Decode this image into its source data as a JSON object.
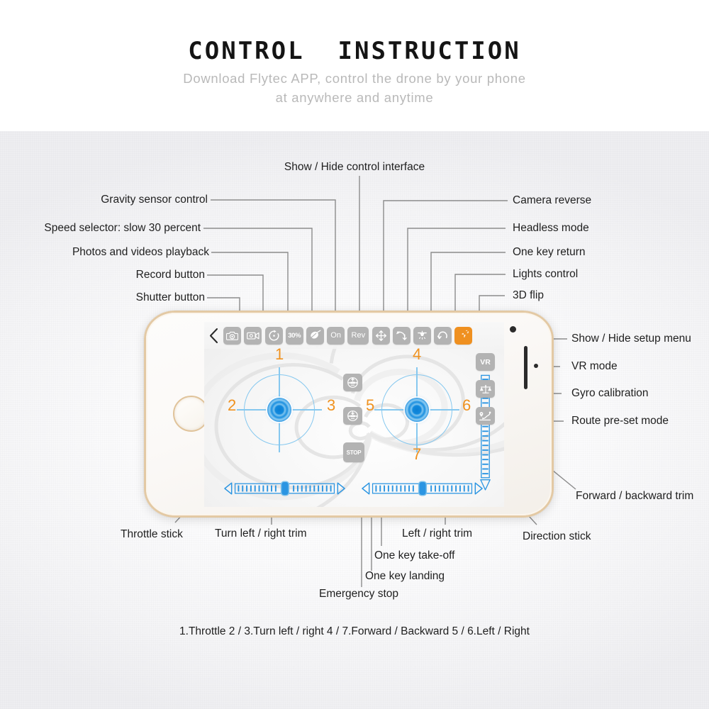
{
  "header": {
    "title": "CONTROL  INSTRUCTION",
    "subtitle_line1": "Download Flytec APP, control the drone by your phone",
    "subtitle_line2": "at anywhere and anytime"
  },
  "colors": {
    "accent_orange": "#ef9020",
    "stick_blue": "#2b95e2",
    "ring_blue": "#86c8ef",
    "button_gray": "#b3b3b3",
    "phone_rim_gold": "#e3c9a4",
    "leader_line": "#8c8c8c"
  },
  "callouts": {
    "left": [
      {
        "id": "gravity-sensor-control",
        "label": "Gravity sensor control"
      },
      {
        "id": "speed-selector",
        "label": "Speed  selector:  slow  30  percent"
      },
      {
        "id": "photos-videos-playback",
        "label": "Photos and videos playback"
      },
      {
        "id": "record-button",
        "label": "Record button"
      },
      {
        "id": "shutter-button",
        "label": "Shutter button"
      }
    ],
    "top_center": {
      "id": "show-hide-control-interface",
      "label": "Show / Hide control interface"
    },
    "right_upper": [
      {
        "id": "camera-reverse",
        "label": "Camera reverse"
      },
      {
        "id": "headless-mode",
        "label": "Headless mode"
      },
      {
        "id": "one-key-return",
        "label": "One key return"
      },
      {
        "id": "lights-control",
        "label": "Lights control"
      },
      {
        "id": "3d-flip",
        "label": "3D flip"
      }
    ],
    "right_side": [
      {
        "id": "show-hide-setup-menu",
        "label": "Show / Hide setup menu"
      },
      {
        "id": "vr-mode",
        "label": "VR mode"
      },
      {
        "id": "gyro-calibration",
        "label": "Gyro  calibration"
      },
      {
        "id": "route-preset-mode",
        "label": "Route pre-set mode"
      },
      {
        "id": "forward-backward-trim",
        "label": "Forward / backward trim"
      }
    ],
    "bottom": [
      {
        "id": "throttle-stick",
        "label": "Throttle stick"
      },
      {
        "id": "turn-left-right-trim",
        "label": "Turn left / right trim"
      },
      {
        "id": "left-right-trim",
        "label": "Left / right trim"
      },
      {
        "id": "direction-stick",
        "label": "Direction stick"
      },
      {
        "id": "one-key-take-off",
        "label": "One key take-off"
      },
      {
        "id": "one-key-landing",
        "label": "One key landing"
      },
      {
        "id": "emergency-stop",
        "label": "Emergency stop"
      }
    ]
  },
  "toolbar": {
    "back_icon": "chevron-left-icon",
    "buttons": [
      {
        "id": "shutter",
        "icon": "camera-icon",
        "label": ""
      },
      {
        "id": "record",
        "icon": "video-camera-icon",
        "label": ""
      },
      {
        "id": "playback",
        "icon": "replay-icon",
        "label": ""
      },
      {
        "id": "speed",
        "icon": "",
        "label": "30%"
      },
      {
        "id": "gravity-sensor",
        "icon": "gyro-top-icon",
        "label": ""
      },
      {
        "id": "lights-toggle",
        "icon": "",
        "label": "On"
      },
      {
        "id": "camera-reverse",
        "icon": "",
        "label": "Rev"
      },
      {
        "id": "headless",
        "icon": "four-arrows-icon",
        "label": ""
      },
      {
        "id": "one-key-return",
        "icon": "return-arrow-icon",
        "label": ""
      },
      {
        "id": "lights-control",
        "icon": "lamp-icon",
        "label": ""
      },
      {
        "id": "3d-flip",
        "icon": "flip-loop-icon",
        "label": ""
      },
      {
        "id": "setup-menu",
        "icon": "gears-icon",
        "label": "",
        "active": true
      }
    ]
  },
  "screen": {
    "right_cluster": [
      {
        "id": "vr-mode",
        "icon": "",
        "label": "VR"
      },
      {
        "id": "gyro-calibration",
        "icon": "balance-scale-icon",
        "label": ""
      },
      {
        "id": "route-preset",
        "icon": "route-pin-icon",
        "label": ""
      }
    ],
    "middle_buttons": [
      {
        "id": "one-key-take-off",
        "icon": "take-off-icon",
        "label": ""
      },
      {
        "id": "one-key-landing",
        "icon": "landing-icon",
        "label": ""
      },
      {
        "id": "emergency-stop",
        "icon": "",
        "label": "STOP"
      }
    ],
    "stick_numbers": {
      "left_up": "1",
      "left_left": "2",
      "left_right": "3",
      "right_up": "4",
      "right_left": "5",
      "right_right": "6",
      "right_down": "7"
    }
  },
  "legend": "1.Throttle  2 / 3.Turn left / right  4 / 7.Forward / Backward  5 / 6.Left / Right"
}
